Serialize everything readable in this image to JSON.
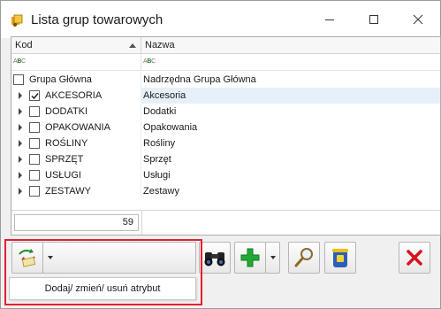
{
  "window": {
    "title": "Lista grup towarowych",
    "icon": "app-icon",
    "buttons": [
      "minimize-icon",
      "maximize-icon",
      "close-icon"
    ]
  },
  "grid": {
    "columns": [
      {
        "label": "Kod",
        "sorted": "ascending"
      },
      {
        "label": "Nazwa"
      }
    ],
    "rows": [
      {
        "kod": "Grupa Główna",
        "nazwa": "Nadrzędna Grupa Główna",
        "level": 0,
        "checked": false,
        "expandable": false,
        "selected": false
      },
      {
        "kod": "AKCESORIA",
        "nazwa": "Akcesoria",
        "level": 1,
        "checked": true,
        "expandable": true,
        "selected": true
      },
      {
        "kod": "DODATKI",
        "nazwa": "Dodatki",
        "level": 1,
        "checked": false,
        "expandable": true,
        "selected": false
      },
      {
        "kod": "OPAKOWANIA",
        "nazwa": "Opakowania",
        "level": 1,
        "checked": false,
        "expandable": true,
        "selected": false
      },
      {
        "kod": "ROŚLINY",
        "nazwa": "Rośliny",
        "level": 1,
        "checked": false,
        "expandable": true,
        "selected": false
      },
      {
        "kod": "SPRZĘT",
        "nazwa": "Sprzęt",
        "level": 1,
        "checked": false,
        "expandable": true,
        "selected": false
      },
      {
        "kod": "USŁUGI",
        "nazwa": "Usługi",
        "level": 1,
        "checked": false,
        "expandable": true,
        "selected": false
      },
      {
        "kod": "ZESTAWY",
        "nazwa": "Zestawy",
        "level": 1,
        "checked": false,
        "expandable": true,
        "selected": false
      }
    ],
    "record_count": "59"
  },
  "toolbar": {
    "attribute_button_icon": "attribute-icon",
    "find_icon": "binoculars-icon",
    "add_icon": "plus-icon",
    "zoom_icon": "magnifier-icon",
    "delete_icon": "trash-icon",
    "close_icon": "red-x-icon"
  },
  "dropdown_menu": {
    "items": [
      "Dodaj/ zmień/ usuń atrybut"
    ]
  },
  "colors": {
    "highlight": "#e4202e",
    "selected_row": "#e6f0fb",
    "add_green": "#22a935",
    "close_red": "#d8121b"
  }
}
